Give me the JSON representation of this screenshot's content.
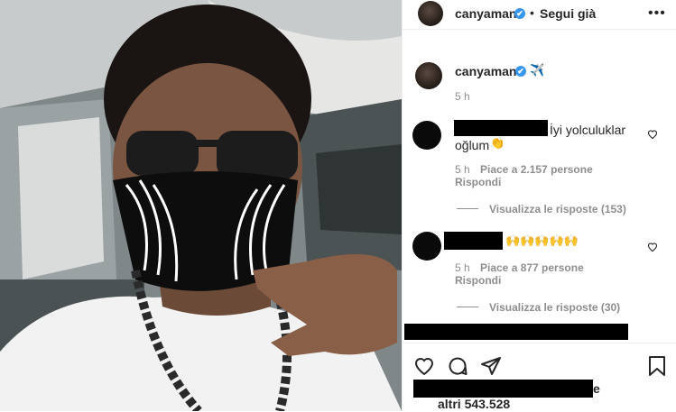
{
  "header": {
    "username": "canyaman",
    "verified_badge": "✔",
    "separator": "•",
    "follow_label": "Segui già",
    "more_label": "•••"
  },
  "caption": {
    "username": "canyaman",
    "verified_badge": "✔",
    "emoji": "✈️",
    "time": "5 h"
  },
  "comments": [
    {
      "text_line1": "İyi yolculuklar",
      "text_line2": "oğlum",
      "emoji": "👏",
      "time": "5 h",
      "likes_label": "Piace a 2.157 persone",
      "reply_label": "Rispondi",
      "view_replies_label": "Visualizza le risposte (153)"
    },
    {
      "emoji": "🙌🙌🙌🙌🙌",
      "time": "5 h",
      "likes_label": "Piace a 877 persone",
      "reply_label": "Rispondi",
      "view_replies_label": "Visualizza le risposte (30)"
    }
  ],
  "likes": {
    "visible_fragment": "e",
    "count_label": "altri 543.528"
  },
  "icons": {
    "heart": "heart-icon",
    "comment": "comment-icon",
    "share": "share-icon",
    "save": "bookmark-icon"
  }
}
